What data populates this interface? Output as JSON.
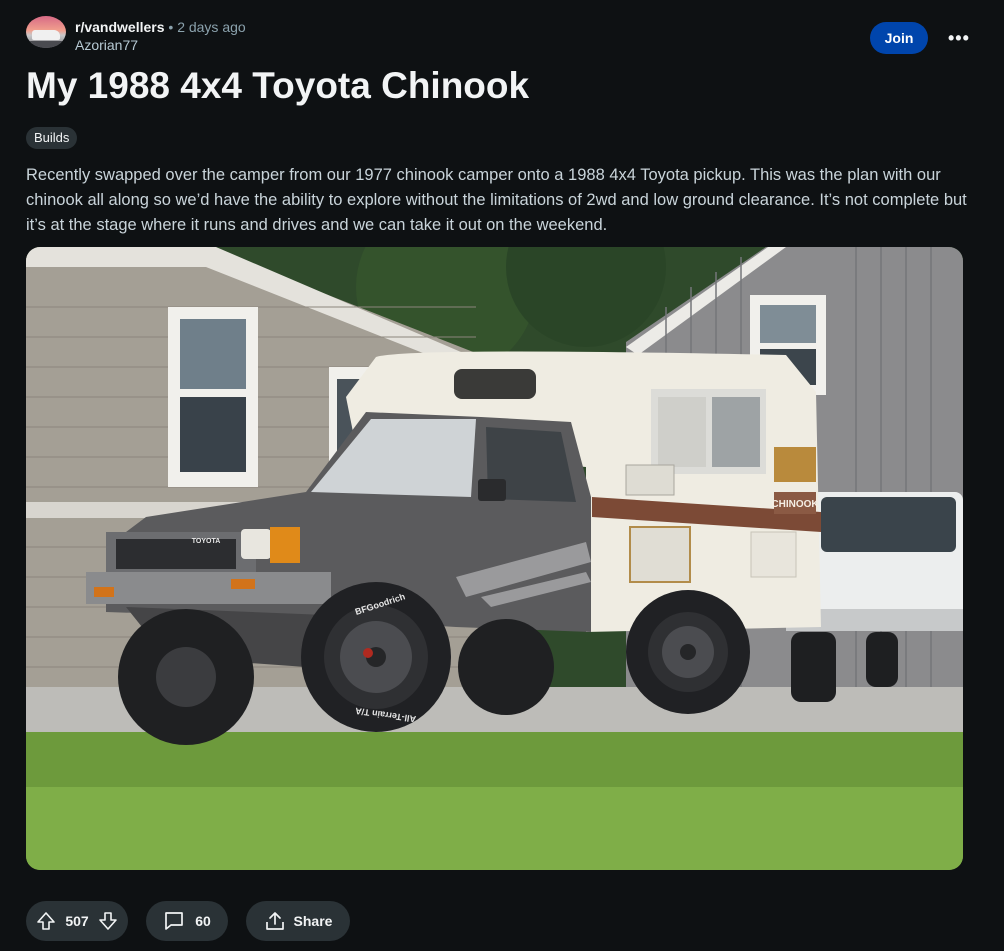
{
  "header": {
    "subreddit": "r/vandwellers",
    "separator": "•",
    "time": "2 days ago",
    "author": "Azorian77",
    "join_label": "Join",
    "more_label": "•••"
  },
  "post": {
    "title": "My 1988 4x4 Toyota Chinook",
    "flair": "Builds",
    "body": "Recently swapped over the camper from our 1977 chinook camper onto a 1988 4x4 Toyota pickup. This was the plan with our chinook all along so we’d have the ability to explore without the limitations of 2wd and low ground clearance. It’s not complete but it’s at the stage where it runs and drives and we can take it out on the weekend.",
    "image_text": {
      "grille_badge": "TOYOTA",
      "camper_badge": "CHINOOK",
      "tire_brand": "BFGoodrich",
      "tire_model": "All-Terrain T/A"
    }
  },
  "actions": {
    "vote_count": "507",
    "comment_count": "60",
    "share_label": "Share"
  },
  "icons": {
    "upvote": "arrow-up-icon",
    "downvote": "arrow-down-icon",
    "comment": "comment-bubble-icon",
    "share": "share-icon",
    "more": "ellipsis-icon"
  },
  "colors": {
    "background": "#0e1113",
    "join_button": "#0045ac",
    "pill": "#2a3236",
    "body_text": "#c9d4da",
    "meta_text": "#8ba2ad"
  }
}
